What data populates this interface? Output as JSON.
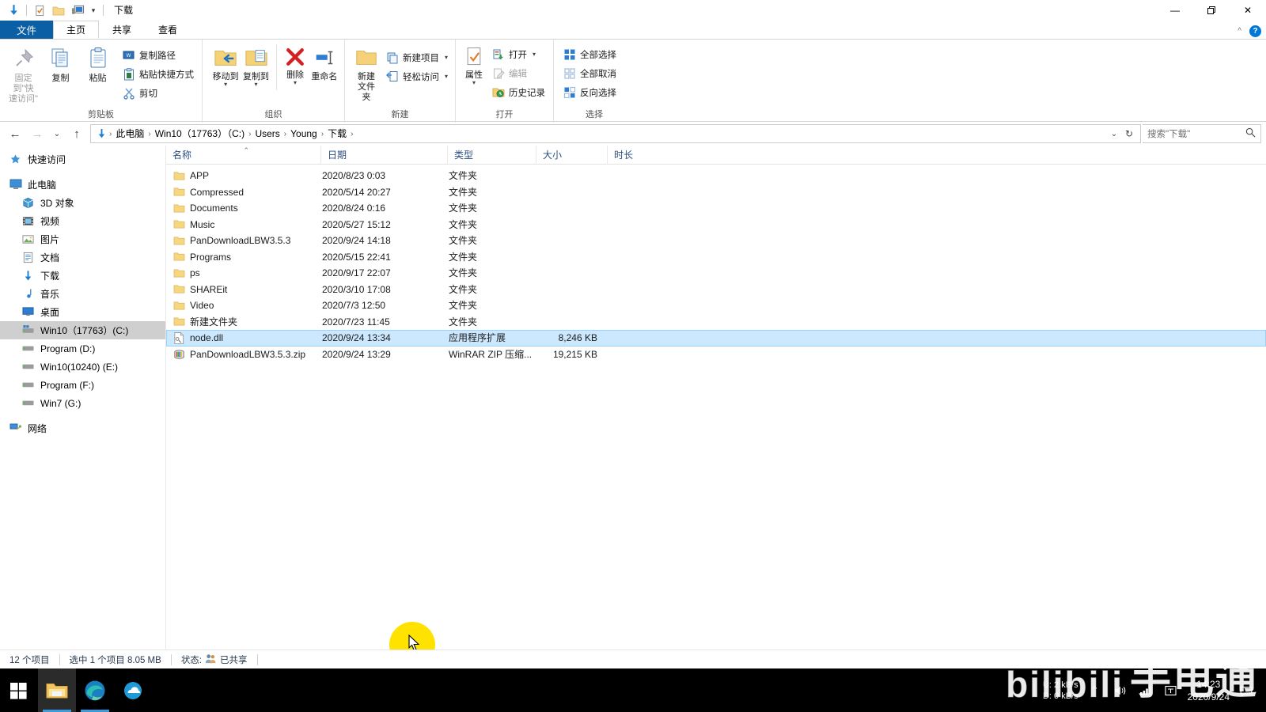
{
  "window": {
    "title": "下载",
    "quick_access_icons": [
      "downloads-arrow-icon",
      "properties-icon",
      "new-folder-icon",
      "computer-icon",
      "customize-chevron-icon"
    ],
    "controls": {
      "minimize": "—",
      "maximize": "❐",
      "close": "✕",
      "collapse_ribbon": "^",
      "help": "?"
    }
  },
  "tabs": [
    {
      "id": "file",
      "label": "文件"
    },
    {
      "id": "home",
      "label": "主页"
    },
    {
      "id": "share",
      "label": "共享"
    },
    {
      "id": "view",
      "label": "查看"
    }
  ],
  "ribbon": {
    "groups": [
      {
        "id": "clipboard",
        "label": "剪贴板",
        "big": [
          {
            "label_line1": "固定到\"快",
            "label_line2": "速访问\"",
            "icon": "pin-icon",
            "dim": true
          },
          {
            "label_line1": "复制",
            "label_line2": "",
            "icon": "copy-icon"
          },
          {
            "label_line1": "粘贴",
            "label_line2": "",
            "icon": "paste-icon"
          }
        ],
        "small": [
          {
            "label": "复制路径",
            "icon": "copy-path-icon"
          },
          {
            "label": "粘贴快捷方式",
            "icon": "paste-shortcut-icon"
          },
          {
            "label": "剪切",
            "icon": "scissors-icon"
          }
        ]
      },
      {
        "id": "organize",
        "label": "组织",
        "big": [
          {
            "label_line1": "移动到",
            "label_line2": "",
            "icon": "move-to-icon",
            "caret": true
          },
          {
            "label_line1": "复制到",
            "label_line2": "",
            "icon": "copy-to-icon",
            "caret": true
          },
          {
            "label_line1": "删除",
            "label_line2": "",
            "icon": "delete-icon",
            "caret": true
          },
          {
            "label_line1": "重命名",
            "label_line2": "",
            "icon": "rename-icon"
          }
        ],
        "small": []
      },
      {
        "id": "new",
        "label": "新建",
        "big": [
          {
            "label_line1": "新建",
            "label_line2": "文件夹",
            "icon": "new-folder-icon"
          }
        ],
        "small": [
          {
            "label": "新建项目",
            "icon": "new-item-icon",
            "caret": true
          },
          {
            "label": "轻松访问",
            "icon": "easy-access-icon",
            "caret": true
          }
        ]
      },
      {
        "id": "open",
        "label": "打开",
        "big": [
          {
            "label_line1": "属性",
            "label_line2": "",
            "icon": "properties-icon",
            "caret": true
          }
        ],
        "small": [
          {
            "label": "打开",
            "icon": "open-icon",
            "caret": true
          },
          {
            "label": "编辑",
            "icon": "edit-icon",
            "dim": true
          },
          {
            "label": "历史记录",
            "icon": "history-icon"
          }
        ]
      },
      {
        "id": "select",
        "label": "选择",
        "big": [],
        "small": [
          {
            "label": "全部选择",
            "icon": "select-all-icon"
          },
          {
            "label": "全部取消",
            "icon": "select-none-icon"
          },
          {
            "label": "反向选择",
            "icon": "invert-selection-icon"
          }
        ]
      }
    ]
  },
  "address": {
    "back": "←",
    "forward": "→",
    "recent": "⌄",
    "up": "↑",
    "crumbs": [
      "此电脑",
      "Win10（17763）（C:)",
      "Users",
      "Young",
      "下载"
    ],
    "separator": "›",
    "dropdown": "⌄",
    "refresh": "↻"
  },
  "search": {
    "placeholder": "搜索\"下载\"",
    "icon": "search-icon"
  },
  "sidebar": {
    "items": [
      {
        "label": "快速访问",
        "icon": "star-icon",
        "level": 0,
        "selected": false
      },
      {
        "label": "此电脑",
        "icon": "computer-icon",
        "level": 0,
        "selected": false,
        "gap_before": true
      },
      {
        "label": "3D 对象",
        "icon": "3d-objects-icon",
        "level": 1,
        "selected": false
      },
      {
        "label": "视频",
        "icon": "videos-icon",
        "level": 1,
        "selected": false
      },
      {
        "label": "图片",
        "icon": "pictures-icon",
        "level": 1,
        "selected": false
      },
      {
        "label": "文档",
        "icon": "documents-icon",
        "level": 1,
        "selected": false
      },
      {
        "label": "下载",
        "icon": "downloads-icon",
        "level": 1,
        "selected": false
      },
      {
        "label": "音乐",
        "icon": "music-icon",
        "level": 1,
        "selected": false
      },
      {
        "label": "桌面",
        "icon": "desktop-icon",
        "level": 1,
        "selected": false
      },
      {
        "label": "Win10（17763）(C:)",
        "icon": "system-drive-icon",
        "level": 1,
        "selected": true
      },
      {
        "label": "Program (D:)",
        "icon": "drive-icon",
        "level": 1,
        "selected": false
      },
      {
        "label": "Win10(10240) (E:)",
        "icon": "drive-icon",
        "level": 1,
        "selected": false
      },
      {
        "label": "Program (F:)",
        "icon": "drive-icon",
        "level": 1,
        "selected": false
      },
      {
        "label": "Win7 (G:)",
        "icon": "drive-icon",
        "level": 1,
        "selected": false
      },
      {
        "label": "网络",
        "icon": "network-icon",
        "level": 0,
        "selected": false,
        "gap_before": true
      }
    ]
  },
  "filelist": {
    "columns": [
      {
        "key": "name",
        "label": "名称",
        "sorted": true,
        "sort_dir": "asc"
      },
      {
        "key": "date",
        "label": "日期"
      },
      {
        "key": "type",
        "label": "类型"
      },
      {
        "key": "size",
        "label": "大小"
      },
      {
        "key": "len",
        "label": "时长"
      }
    ],
    "rows": [
      {
        "name": "APP",
        "date": "2020/8/23 0:03",
        "type": "文件夹",
        "size": "",
        "len": "",
        "icon": "folder-icon",
        "selected": false
      },
      {
        "name": "Compressed",
        "date": "2020/5/14 20:27",
        "type": "文件夹",
        "size": "",
        "len": "",
        "icon": "folder-icon",
        "selected": false
      },
      {
        "name": "Documents",
        "date": "2020/8/24 0:16",
        "type": "文件夹",
        "size": "",
        "len": "",
        "icon": "folder-icon",
        "selected": false
      },
      {
        "name": "Music",
        "date": "2020/5/27 15:12",
        "type": "文件夹",
        "size": "",
        "len": "",
        "icon": "folder-icon",
        "selected": false
      },
      {
        "name": "PanDownloadLBW3.5.3",
        "date": "2020/9/24 14:18",
        "type": "文件夹",
        "size": "",
        "len": "",
        "icon": "folder-icon",
        "selected": false
      },
      {
        "name": "Programs",
        "date": "2020/5/15 22:41",
        "type": "文件夹",
        "size": "",
        "len": "",
        "icon": "folder-icon",
        "selected": false
      },
      {
        "name": "ps",
        "date": "2020/9/17 22:07",
        "type": "文件夹",
        "size": "",
        "len": "",
        "icon": "folder-icon",
        "selected": false
      },
      {
        "name": "SHAREit",
        "date": "2020/3/10 17:08",
        "type": "文件夹",
        "size": "",
        "len": "",
        "icon": "folder-icon",
        "selected": false
      },
      {
        "name": "Video",
        "date": "2020/7/3 12:50",
        "type": "文件夹",
        "size": "",
        "len": "",
        "icon": "folder-icon",
        "selected": false
      },
      {
        "name": "新建文件夹",
        "date": "2020/7/23 11:45",
        "type": "文件夹",
        "size": "",
        "len": "",
        "icon": "folder-icon",
        "selected": false
      },
      {
        "name": "node.dll",
        "date": "2020/9/24 13:34",
        "type": "应用程序扩展",
        "size": "8,246 KB",
        "len": "",
        "icon": "dll-icon",
        "selected": true
      },
      {
        "name": "PanDownloadLBW3.5.3.zip",
        "date": "2020/9/24 13:29",
        "type": "WinRAR ZIP 压缩...",
        "size": "19,215 KB",
        "len": "",
        "icon": "winrar-zip-icon",
        "selected": false
      }
    ]
  },
  "statusbar": {
    "item_count": "12 个项目",
    "selection": "选中 1 个项目  8.05 MB",
    "state_label": "状态:",
    "state_value": "已共享"
  },
  "taskbar": {
    "start": "start-icon",
    "apps": [
      {
        "name": "file-explorer",
        "icon": "folder-icon",
        "active": true
      },
      {
        "name": "microsoft-edge",
        "icon": "edge-icon",
        "active": true
      },
      {
        "name": "cloud-app",
        "icon": "cloud-icon",
        "active": false
      }
    ],
    "tray": {
      "upload_label": "U:",
      "upload_value": "2 kB/s",
      "download_label": "D:",
      "download_value": "0 kB/s",
      "icons": [
        "chevron-up-icon",
        "volume-icon",
        "network-icon",
        "ime-icon"
      ],
      "time": "14:23",
      "date": "2020/9/24"
    }
  },
  "watermark": {
    "text_left": "bilibili",
    "text_right": "手电通"
  },
  "colors": {
    "accent": "#0078d7",
    "file_tab": "#0b5fa5",
    "selection_bg": "#cce8ff",
    "selection_border": "#99d1ff",
    "column_header_text": "#2b4f81",
    "cursor_highlight": "#ffe200",
    "taskbar": "#000000"
  }
}
